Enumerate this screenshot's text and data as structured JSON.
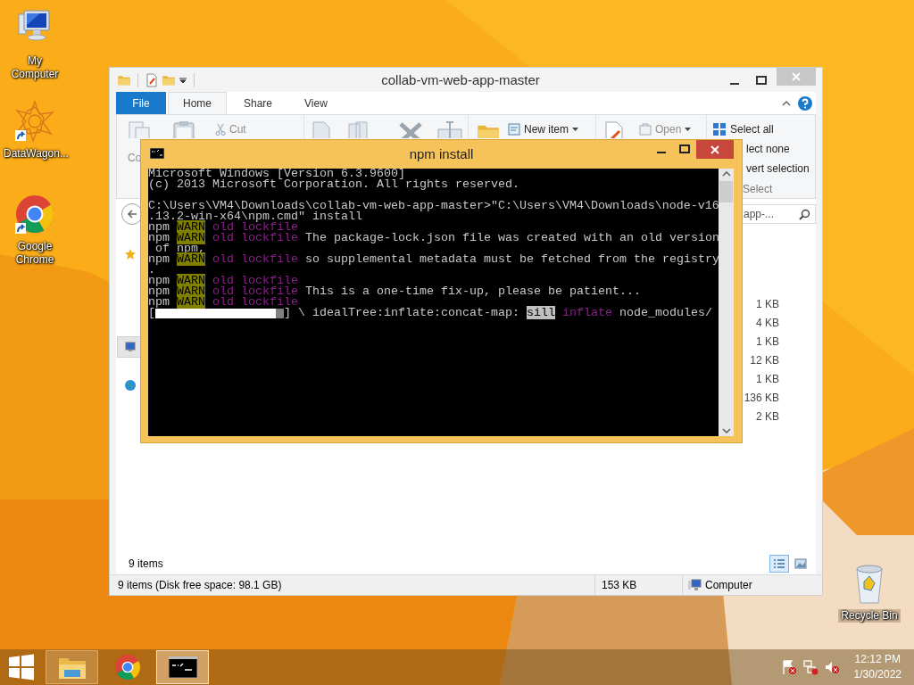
{
  "desktop_icons": [
    {
      "label": "My Computer",
      "kind": "computer",
      "shortcut": false
    },
    {
      "label": "DataWagon...",
      "kind": "star",
      "shortcut": true
    },
    {
      "label": "Google Chrome",
      "kind": "browser",
      "shortcut": true
    }
  ],
  "recycle_bin": {
    "label": "Recycle Bin"
  },
  "explorer": {
    "title": "collab-vm-web-app-master",
    "file_tab": "File",
    "tabs": [
      {
        "label": "Home",
        "selected": true
      },
      {
        "label": "Share",
        "selected": false
      },
      {
        "label": "View",
        "selected": false
      }
    ],
    "ribbon": {
      "copy": {
        "label": "Co",
        "disabled": true
      },
      "cut": {
        "label": "Cut",
        "disabled": true
      },
      "new_item": {
        "label": "New item",
        "disabled": false
      },
      "open": {
        "label": "Open",
        "disabled": true
      },
      "select_all": "Select all",
      "select_none": "lect none",
      "invert_selection": "vert selection",
      "select_group": "Select"
    },
    "search": {
      "placeholder": "app-..."
    },
    "nav_pane": [
      {
        "kind": "favorites",
        "selected": false
      },
      {
        "kind": "computer",
        "selected": true
      },
      {
        "kind": "network",
        "selected": false
      }
    ],
    "sizes": [
      "1 KB",
      "4 KB",
      "1 KB",
      "12 KB",
      "1 KB",
      "136 KB",
      "2 KB"
    ],
    "item_count": "9 items",
    "view_buttons": [
      {
        "kind": "details",
        "selected": true
      },
      {
        "kind": "large-icons",
        "selected": false
      }
    ],
    "status_bar": {
      "summary": "9 items (Disk free space: 98.1 GB)",
      "size": "153 KB",
      "location": "Computer"
    }
  },
  "console": {
    "title": "npm install",
    "lines": [
      {
        "segments": [
          {
            "kind": "plain",
            "text": "Microsoft Windows [Version 6.3.9600]"
          }
        ]
      },
      {
        "segments": [
          {
            "kind": "plain",
            "text": "(c) 2013 Microsoft Corporation. All rights reserved."
          }
        ]
      },
      {
        "blank_before": true,
        "segments": [
          {
            "kind": "plain",
            "text": "C:\\Users\\VM4\\Downloads\\collab-vm-web-app-master>\"C:\\Users\\VM4\\Downloads\\node-v16"
          }
        ]
      },
      {
        "segments": [
          {
            "kind": "plain",
            "text": ".13.2-win-x64\\npm.cmd\" install"
          }
        ]
      },
      {
        "segments": [
          {
            "kind": "plain",
            "text": "npm "
          },
          {
            "kind": "warn",
            "text": "WARN"
          },
          {
            "kind": "magenta",
            "text": " old lockfile"
          }
        ]
      },
      {
        "segments": [
          {
            "kind": "plain",
            "text": "npm "
          },
          {
            "kind": "warn",
            "text": "WARN"
          },
          {
            "kind": "magenta",
            "text": " old lockfile"
          },
          {
            "kind": "plain",
            "text": " The package-lock.json file was created with an old version"
          }
        ]
      },
      {
        "segments": [
          {
            "kind": "plain",
            "text": " of npm,"
          }
        ]
      },
      {
        "segments": [
          {
            "kind": "plain",
            "text": "npm "
          },
          {
            "kind": "warn",
            "text": "WARN"
          },
          {
            "kind": "magenta",
            "text": " old lockfile"
          },
          {
            "kind": "plain",
            "text": " so supplemental metadata must be fetched from the registry"
          }
        ]
      },
      {
        "segments": [
          {
            "kind": "plain",
            "text": "."
          }
        ]
      },
      {
        "segments": [
          {
            "kind": "plain",
            "text": "npm "
          },
          {
            "kind": "warn",
            "text": "WARN"
          },
          {
            "kind": "magenta",
            "text": " old lockfile"
          }
        ]
      },
      {
        "segments": [
          {
            "kind": "plain",
            "text": "npm "
          },
          {
            "kind": "warn",
            "text": "WARN"
          },
          {
            "kind": "magenta",
            "text": " old lockfile"
          },
          {
            "kind": "plain",
            "text": " This is a one-time fix-up, please be patient..."
          }
        ]
      },
      {
        "segments": [
          {
            "kind": "plain",
            "text": "npm "
          },
          {
            "kind": "warn",
            "text": "WARN"
          },
          {
            "kind": "magenta",
            "text": " old lockfile"
          }
        ]
      },
      {
        "segments": [
          {
            "kind": "plain",
            "text": "["
          },
          {
            "kind": "bar",
            "level": 0.94
          },
          {
            "kind": "plain",
            "text": "] \\ idealTree:inflate:concat-map: "
          },
          {
            "kind": "inverse",
            "text": "sill"
          },
          {
            "kind": "magenta",
            "text": " inflate"
          },
          {
            "kind": "plain",
            "text": " node_modules/"
          }
        ]
      }
    ]
  },
  "taskbar": {
    "buttons": [
      {
        "kind": "explorer",
        "running": true,
        "active": false
      },
      {
        "kind": "browser",
        "running": false,
        "active": false
      },
      {
        "kind": "console",
        "running": true,
        "active": true
      }
    ],
    "clock": {
      "time": "12:12 PM",
      "date": "1/30/2022"
    }
  }
}
